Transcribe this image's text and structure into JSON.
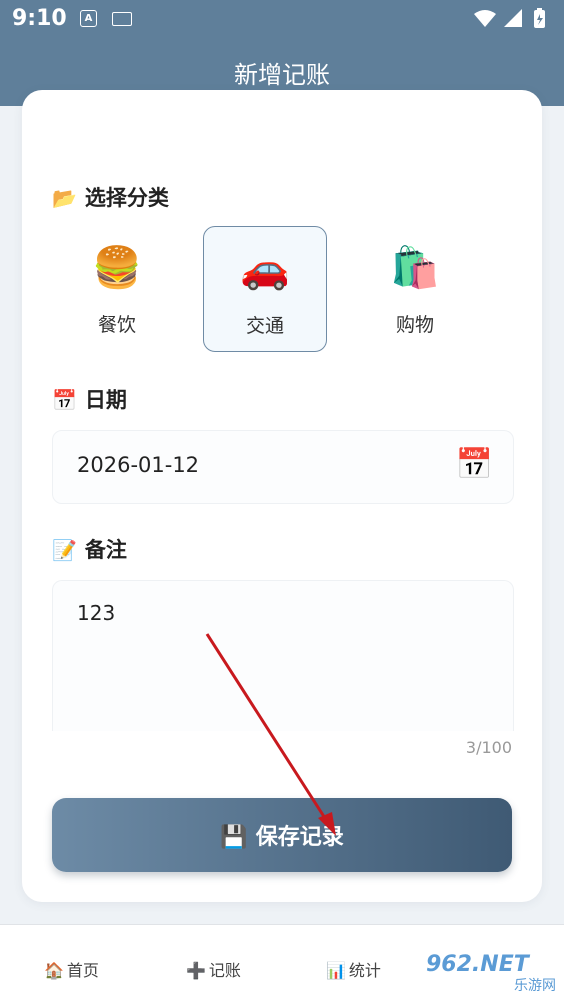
{
  "status": {
    "time": "9:10",
    "a_icon": "A"
  },
  "header": {
    "title": "新增记账"
  },
  "category": {
    "title": "选择分类",
    "title_icon": "📂",
    "items": [
      {
        "label": "餐饮",
        "icon": "🍔"
      },
      {
        "label": "交通",
        "icon": "🚗",
        "selected": true
      },
      {
        "label": "购物",
        "icon": "🛍️"
      }
    ]
  },
  "date": {
    "title": "日期",
    "title_icon": "📅",
    "value": "2026-01-12",
    "picker_icon": "📅"
  },
  "note": {
    "title": "备注",
    "title_icon": "📝",
    "value": "123",
    "count": "3/100"
  },
  "save": {
    "label": "保存记录",
    "icon": "💾"
  },
  "tabs": [
    {
      "label": "首页",
      "icon": "🏠"
    },
    {
      "label": "记账",
      "icon": "➕"
    },
    {
      "label": "统计",
      "icon": "📊"
    }
  ],
  "watermark": {
    "top": "962.NET",
    "bottom": "乐游网"
  },
  "colors": {
    "header": "#5f7f9a",
    "selected_border": "#6f8ba5",
    "button_start": "#6d8ba6",
    "button_end": "#3f5a74"
  }
}
